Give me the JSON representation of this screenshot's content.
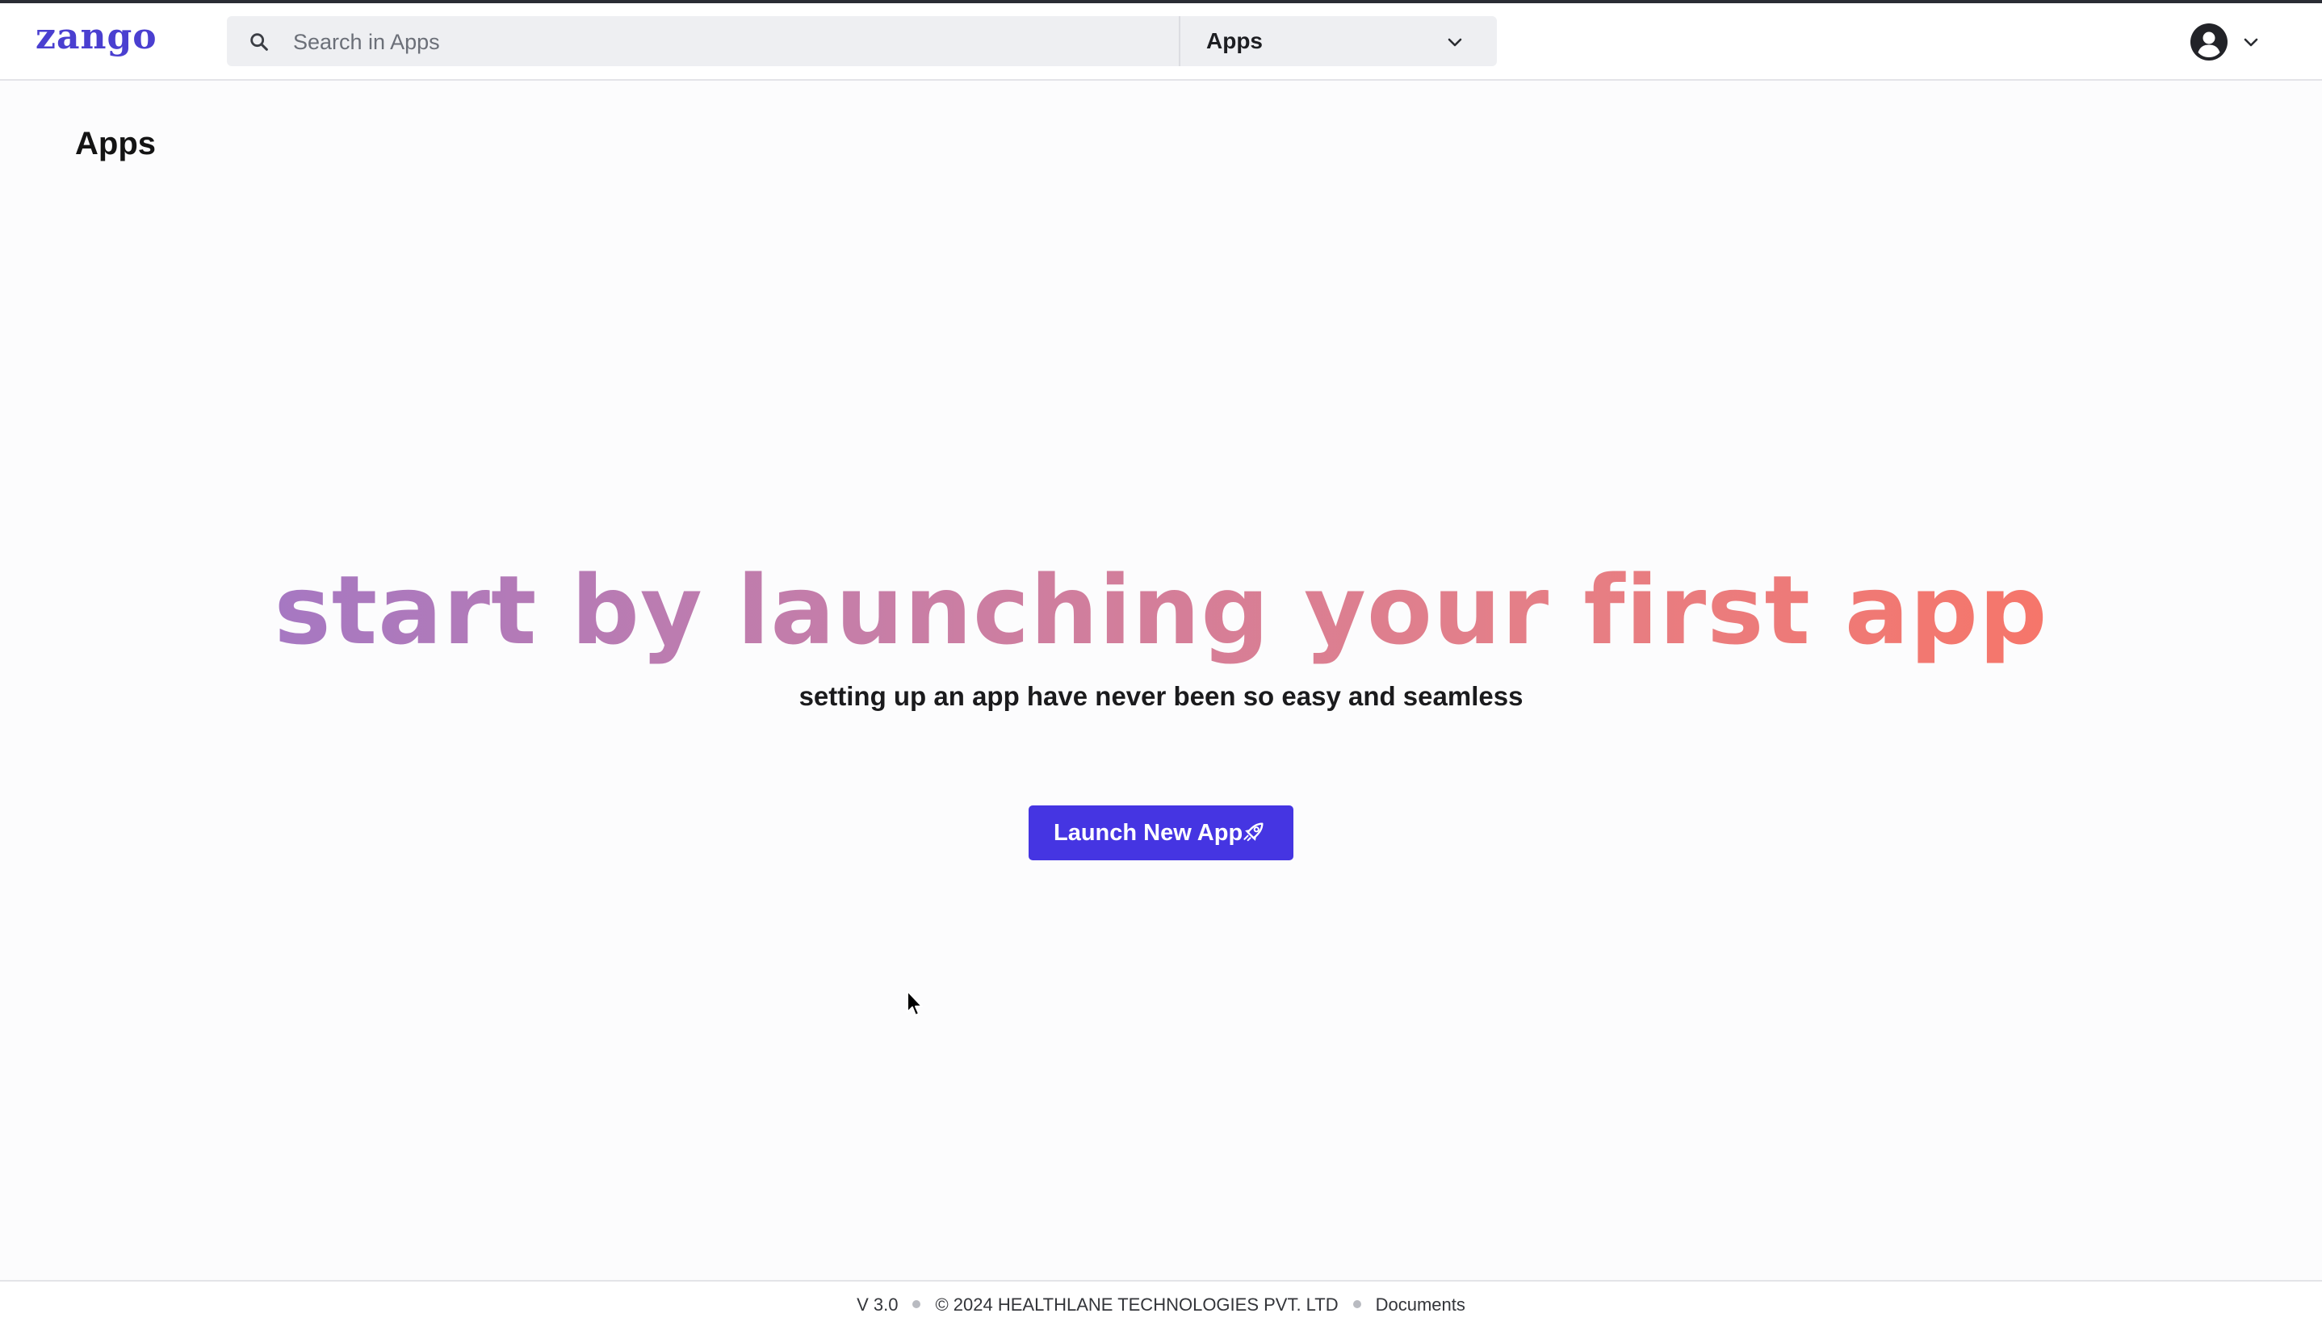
{
  "header": {
    "logo_text": "zango",
    "search": {
      "placeholder": "Search in Apps",
      "value": ""
    },
    "scope_select": {
      "selected": "Apps"
    },
    "icons": {
      "search": "search-icon",
      "scope_chevron": "chevron-down-icon",
      "avatar": "user-avatar-icon",
      "user_chevron": "chevron-down-icon"
    }
  },
  "main": {
    "page_title": "Apps",
    "hero_title": "start by launching your first app",
    "hero_subtitle": "setting up an app have never been so easy and seamless",
    "launch_button": {
      "label": "Launch New App",
      "icon": "rocket-icon"
    }
  },
  "footer": {
    "version": "V 3.0",
    "copyright": "© 2024 HEALTHLANE TECHNOLOGIES PVT. LTD",
    "documents_link": "Documents"
  },
  "colors": {
    "brand": "#4a3fd0",
    "button": "#4535e2",
    "gradient_start": "#a678c2",
    "gradient_end": "#f6766a"
  }
}
